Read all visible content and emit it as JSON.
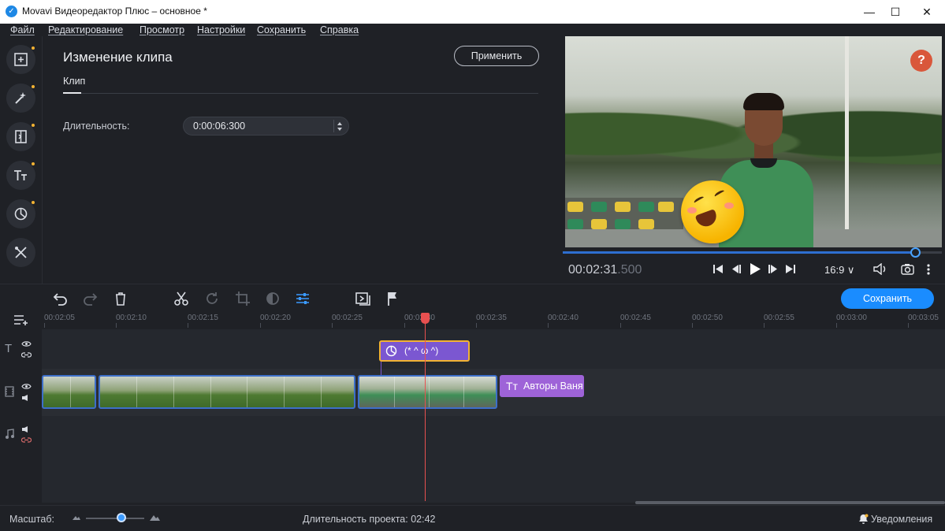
{
  "window": {
    "title": "Movavi Видеоредактор Плюс – основное *",
    "minimize": "—",
    "maximize": "☐",
    "close": "✕"
  },
  "menu": [
    "Файл",
    "Редактирование",
    "Просмотр",
    "Настройки",
    "Сохранить",
    "Справка"
  ],
  "left_tools": [
    "import-icon",
    "magic-wand-icon",
    "transitions-icon",
    "titles-icon",
    "stickers-icon",
    "more-tools-icon"
  ],
  "panel": {
    "title": "Изменение клипа",
    "apply_label": "Применить",
    "tab": "Клип",
    "duration_label": "Длительность:",
    "duration_value": "0:00:06:300"
  },
  "preview": {
    "help": "?",
    "timecode_main": "00:02:31",
    "timecode_ms": ".500",
    "aspect_ratio": "16:9 ∨",
    "scrub_progress": 0.935
  },
  "toolbar": {
    "save_label": "Сохранить"
  },
  "ruler": [
    "00:02:05",
    "00:02:10",
    "00:02:15",
    "00:02:20",
    "00:02:25",
    "00:02:30",
    "00:02:35",
    "00:02:40",
    "00:02:45",
    "00:02:50",
    "00:02:55",
    "00:03:00",
    "00:03:05"
  ],
  "timeline": {
    "overlay_clip_label": "(* ^ ω ^)",
    "title_clip_label": "Авторы Ваня"
  },
  "status": {
    "zoom_label": "Масштаб:",
    "project_duration": "Длительность проекта:  02:42",
    "notifications": "Уведомления"
  },
  "colors": {
    "accent": "#1a8cff",
    "playhead": "#e85050",
    "overlay_clip": "#7b57d1",
    "title_clip": "#9e63d8",
    "selection": "#f2b233"
  }
}
